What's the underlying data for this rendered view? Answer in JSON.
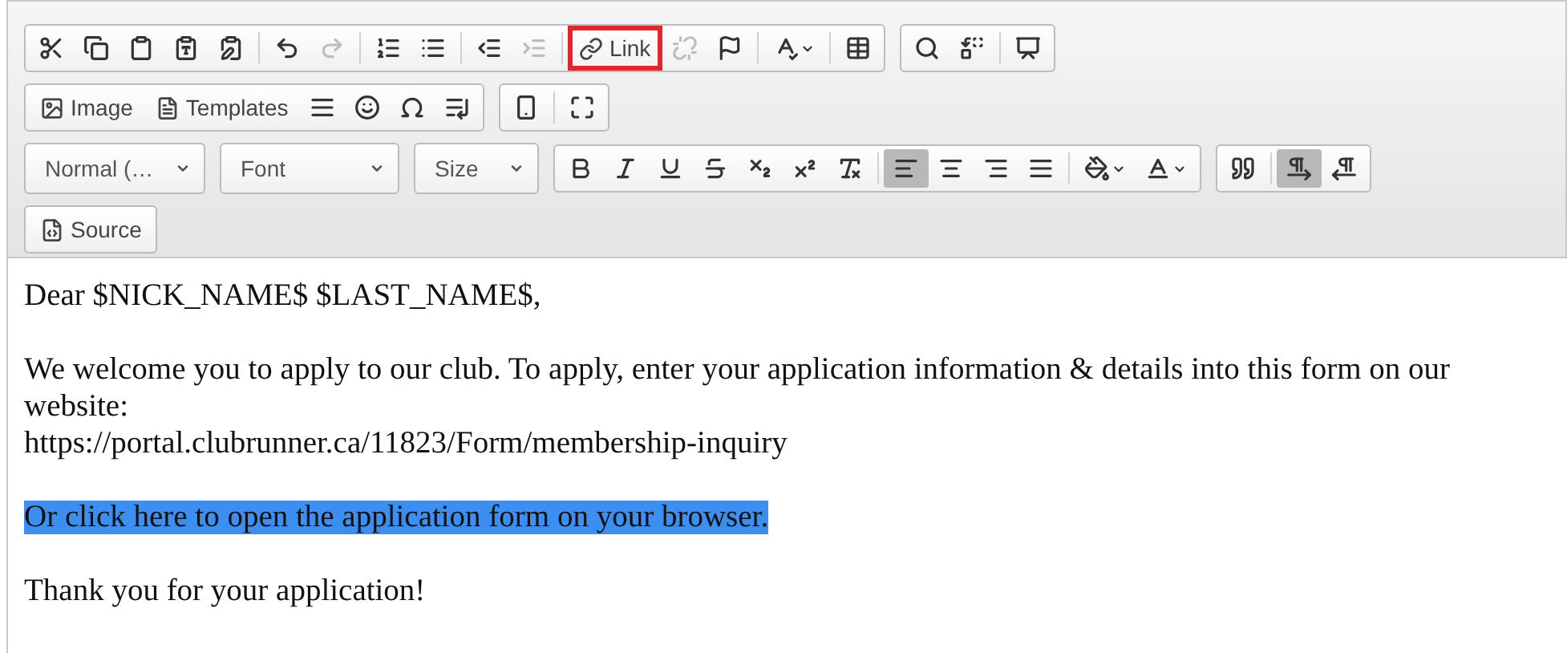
{
  "toolbar": {
    "rows": [
      {
        "groups": [
          {
            "sections": [
              [
                {
                  "kind": "icon",
                  "pressed": false,
                  "disabled": false
                },
                {
                  "kind": "icon",
                  "pressed": false,
                  "disabled": false
                },
                {
                  "kind": "icon",
                  "pressed": false,
                  "disabled": false
                },
                {
                  "kind": "icon",
                  "pressed": false,
                  "disabled": false
                },
                {
                  "kind": "icon",
                  "pressed": false,
                  "disabled": false
                }
              ],
              [
                {
                  "kind": "icon",
                  "pressed": false,
                  "disabled": false
                },
                {
                  "kind": "icon",
                  "pressed": false,
                  "disabled": true
                }
              ],
              [
                {
                  "kind": "icon",
                  "pressed": false,
                  "disabled": false
                },
                {
                  "kind": "icon",
                  "pressed": false,
                  "disabled": false
                }
              ],
              [
                {
                  "kind": "icon",
                  "pressed": false,
                  "disabled": false
                },
                {
                  "kind": "icon",
                  "pressed": false,
                  "disabled": true
                }
              ],
              [
                {
                  "kind": "label",
                  "label": "Link",
                  "highlighted": true
                },
                {
                  "kind": "icon",
                  "pressed": false,
                  "disabled": true
                },
                {
                  "kind": "icon",
                  "pressed": false,
                  "disabled": false
                }
              ],
              [
                {
                  "kind": "icon",
                  "pressed": false,
                  "disabled": false
                }
              ],
              [
                {
                  "kind": "icon",
                  "pressed": false,
                  "disabled": false
                }
              ]
            ]
          },
          {
            "sections": [
              [
                {
                  "kind": "icon",
                  "pressed": false,
                  "disabled": false
                },
                {
                  "kind": "icon",
                  "pressed": false,
                  "disabled": false
                }
              ],
              [
                {
                  "kind": "icon",
                  "pressed": false,
                  "disabled": false
                }
              ]
            ]
          }
        ]
      },
      {
        "groups": [
          {
            "sections": [
              [
                {
                  "kind": "label",
                  "label": "Image",
                  "highlighted": false
                },
                {
                  "kind": "label",
                  "label": "Templates",
                  "highlighted": false
                },
                {
                  "kind": "icon",
                  "pressed": false,
                  "disabled": false
                },
                {
                  "kind": "icon",
                  "pressed": false,
                  "disabled": false
                },
                {
                  "kind": "icon",
                  "pressed": false,
                  "disabled": false
                },
                {
                  "kind": "icon",
                  "pressed": false,
                  "disabled": false
                }
              ]
            ]
          },
          {
            "sections": [
              [
                {
                  "kind": "icon",
                  "pressed": false,
                  "disabled": false
                }
              ],
              [
                {
                  "kind": "icon",
                  "pressed": false,
                  "disabled": false
                }
              ]
            ]
          }
        ]
      },
      {
        "groups": [
          {
            "sections": [
              [
                {
                  "kind": "combo",
                  "label": "Normal (…"
                }
              ]
            ]
          },
          {
            "sections": [
              [
                {
                  "kind": "combo",
                  "label": "Font"
                }
              ]
            ]
          },
          {
            "sections": [
              [
                {
                  "kind": "combo",
                  "label": "Size"
                }
              ]
            ]
          },
          {
            "sections": [
              [
                {
                  "kind": "icon",
                  "pressed": false,
                  "disabled": false
                },
                {
                  "kind": "icon",
                  "pressed": false,
                  "disabled": false
                },
                {
                  "kind": "icon",
                  "pressed": false,
                  "disabled": false
                },
                {
                  "kind": "icon",
                  "pressed": false,
                  "disabled": false
                },
                {
                  "kind": "icon",
                  "pressed": false,
                  "disabled": false
                },
                {
                  "kind": "icon",
                  "pressed": false,
                  "disabled": false
                },
                {
                  "kind": "icon",
                  "pressed": false,
                  "disabled": false
                }
              ],
              [
                {
                  "kind": "icon",
                  "pressed": true,
                  "disabled": false
                },
                {
                  "kind": "icon",
                  "pressed": false,
                  "disabled": false
                },
                {
                  "kind": "icon",
                  "pressed": false,
                  "disabled": false
                },
                {
                  "kind": "icon",
                  "pressed": false,
                  "disabled": false
                }
              ],
              [
                {
                  "kind": "icon",
                  "pressed": false,
                  "disabled": false
                },
                {
                  "kind": "icon",
                  "pressed": false,
                  "disabled": false
                }
              ]
            ]
          },
          {
            "sections": [
              [
                {
                  "kind": "icon",
                  "pressed": false,
                  "disabled": false
                }
              ],
              [
                {
                  "kind": "icon",
                  "pressed": true,
                  "disabled": false
                },
                {
                  "kind": "icon",
                  "pressed": false,
                  "disabled": false
                }
              ]
            ]
          }
        ]
      },
      {
        "groups": [
          {
            "sections": [
              [
                {
                  "kind": "label",
                  "label": "Source",
                  "highlighted": false
                }
              ]
            ]
          }
        ]
      }
    ]
  },
  "content": {
    "paragraphs": [
      {
        "lines": [
          "Dear $NICK_NAME$ $LAST_NAME$,"
        ],
        "selected": false
      },
      {
        "lines": [
          "We welcome you to apply to our club. To apply, enter your application information & details into this form on our website:",
          "https://portal.clubrunner.ca/11823/Form/membership-inquiry"
        ],
        "selected": false
      },
      {
        "lines": [
          "Or click here to open the application form on your browser."
        ],
        "selected": true
      },
      {
        "lines": [
          "Thank you for your application!"
        ],
        "selected": false
      }
    ]
  }
}
